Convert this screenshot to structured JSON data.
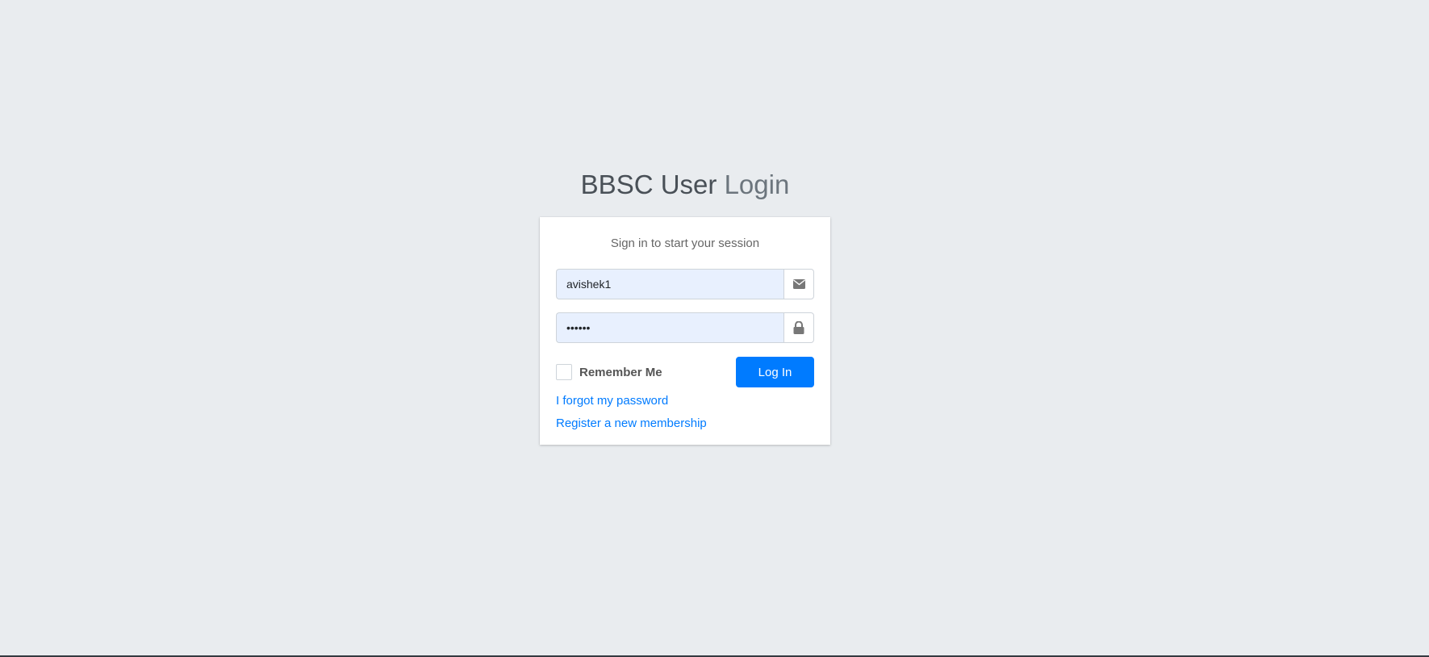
{
  "header": {
    "title_strong": "BBSC User",
    "title_light": "Login"
  },
  "form": {
    "message": "Sign in to start your session",
    "username_value": "avishek1",
    "password_value": "••••••",
    "remember_label": "Remember Me",
    "login_label": "Log In"
  },
  "links": {
    "forgot": "I forgot my password",
    "register": "Register a new membership"
  },
  "icons": {
    "username": "envelope-icon",
    "password": "lock-icon"
  },
  "colors": {
    "primary": "#007bff",
    "background": "#e9ecef",
    "input_autofill": "#e8f0fe"
  }
}
